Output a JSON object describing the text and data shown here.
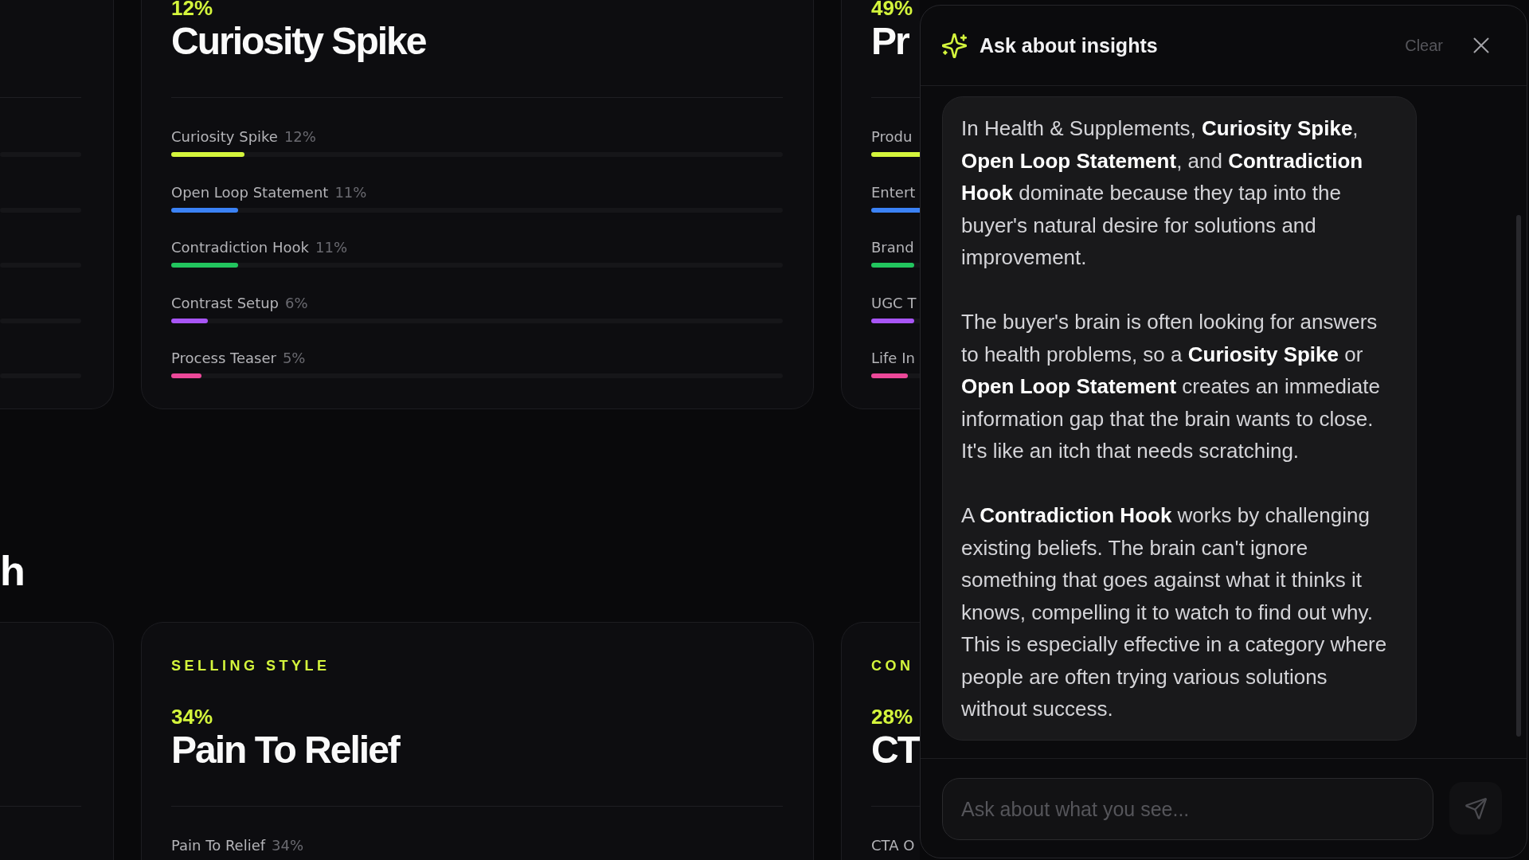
{
  "sections": [
    {
      "cards": [
        {
          "percent": "12%",
          "title": "Curiosity Spike",
          "rows": [
            {
              "label": "Curiosity Spike",
              "percent": "12%",
              "level": 0.12,
              "color": "#d4f53c"
            },
            {
              "label": "Open Loop Statement",
              "percent": "11%",
              "level": 0.11,
              "color": "#3b82f6"
            },
            {
              "label": "Contradiction Hook",
              "percent": "11%",
              "level": 0.11,
              "color": "#22c55e"
            },
            {
              "label": "Contrast Setup",
              "percent": "6%",
              "level": 0.06,
              "color": "#a855f7"
            },
            {
              "label": "Process Teaser",
              "percent": "5%",
              "level": 0.05,
              "color": "#ec4899"
            }
          ]
        },
        {
          "percent": "49%",
          "title": "Pr",
          "rows": [
            {
              "label": "Produ",
              "level": 0.49,
              "color": "#d4f53c"
            },
            {
              "label": "Entert",
              "level": 0.1,
              "color": "#3b82f6"
            },
            {
              "label": "Brand",
              "level": 0.07,
              "color": "#22c55e"
            },
            {
              "label": "UGC T",
              "level": 0.07,
              "color": "#a855f7"
            },
            {
              "label": "Life In",
              "level": 0.06,
              "color": "#ec4899"
            }
          ]
        }
      ]
    },
    {
      "heading": "h",
      "cards": [
        {
          "label": "SELLING STYLE",
          "percent": "34%",
          "title": "Pain To Relief",
          "rows": [
            {
              "label": "Pain To Relief",
              "percent": "34%"
            }
          ]
        },
        {
          "label": "CON",
          "percent": "28%",
          "title": "CT",
          "rows": [
            {
              "label": "CTA O"
            }
          ]
        }
      ]
    }
  ],
  "panel": {
    "title": "Ask about insights",
    "clear": "Clear",
    "message": {
      "paragraphs": [
        "In Health & Supplements, **Curiosity Spike**, **Open Loop Statement**, and **Contradiction Hook** dominate because they tap into the buyer's natural desire for solutions and improvement.",
        "The buyer's brain is often looking for answers to health problems, so a **Curiosity Spike** or **Open Loop Statement** creates an immediate information gap that the brain wants to close. It's like an itch that needs scratching.",
        "A **Contradiction Hook** works by challenging existing beliefs. The brain can't ignore something that goes against what it thinks it knows, compelling it to watch to find out why. This is especially effective in a category where people are often trying various solutions without success."
      ]
    },
    "input": {
      "placeholder": "Ask about what you see..."
    }
  }
}
